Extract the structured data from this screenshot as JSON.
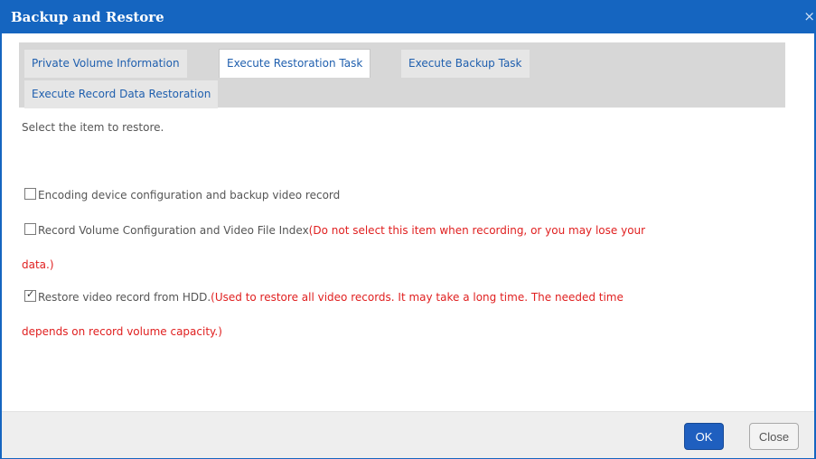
{
  "dialog": {
    "title": "Backup and Restore",
    "close_glyph": "×"
  },
  "tabs": [
    {
      "label": "Private Volume Information",
      "active": false
    },
    {
      "label": "Execute Restoration Task",
      "active": true
    },
    {
      "label": "Execute Backup Task",
      "active": false
    },
    {
      "label": "Execute Record Data Restoration",
      "active": false
    }
  ],
  "content": {
    "instruction": "Select the item to restore.",
    "options": [
      {
        "label": "Encoding device configuration and backup video record",
        "warning_line1": "",
        "warning_line2": "",
        "checked": false
      },
      {
        "label": "Record Volume Configuration and Video File Index",
        "warning_line1": "(Do not select this item when recording, or you may lose your",
        "warning_line2": "data.)",
        "checked": false
      },
      {
        "label": "Restore video record from HDD.",
        "warning_line1": "(Used to restore all video records. It may take a long time. The needed time",
        "warning_line2": "depends on record volume capacity.)",
        "checked": true
      }
    ]
  },
  "footer": {
    "ok_label": "OK",
    "close_label": "Close"
  },
  "colors": {
    "titlebar": "#1565c0",
    "link_text": "#1f5fae",
    "warning": "#e02020",
    "ok_button": "#1f5fbf"
  }
}
